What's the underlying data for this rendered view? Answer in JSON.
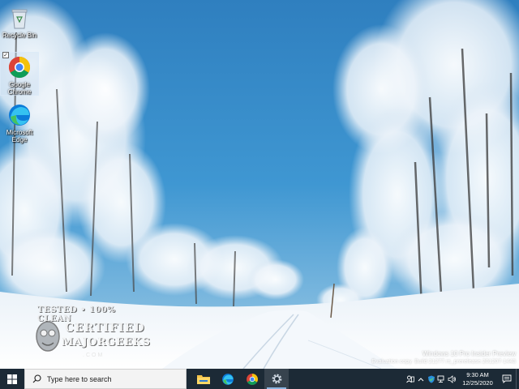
{
  "desktop": {
    "icons": [
      {
        "label": "Recycle Bin",
        "icon": "recycle-bin-icon"
      },
      {
        "label": "Google Chrome",
        "icon": "chrome-icon",
        "selected": true
      },
      {
        "label": "Microsoft Edge",
        "icon": "edge-icon"
      }
    ],
    "watermark": {
      "line1": "TESTED • 100% CLEAN",
      "line2": "CERTIFIED",
      "line3": "MAJORGEEKS",
      "line4": ".COM"
    },
    "build": {
      "line1": "Windows 10 Pro Insider Preview",
      "line2": "Evaluation copy. Build 21277.rs_prerelease.201207-1443"
    }
  },
  "taskbar": {
    "start_icon": "windows-logo-icon",
    "search_placeholder": "Type here to search",
    "apps": [
      {
        "name": "file-explorer",
        "icon": "folder-icon"
      },
      {
        "name": "edge",
        "icon": "edge-icon"
      },
      {
        "name": "chrome",
        "icon": "chrome-icon"
      },
      {
        "name": "settings",
        "icon": "gear-icon",
        "active": true
      }
    ],
    "tray": {
      "icons": [
        "people-icon",
        "chevron-up-icon",
        "defender-icon",
        "network-icon",
        "volume-icon"
      ],
      "time": "9:30 AM",
      "date": "12/25/2020",
      "notification_icon": "action-center-icon"
    }
  },
  "colors": {
    "taskbar_bg": "#1c2a36",
    "sky": "#3a8fc8",
    "accent": "#8ab4e0"
  }
}
